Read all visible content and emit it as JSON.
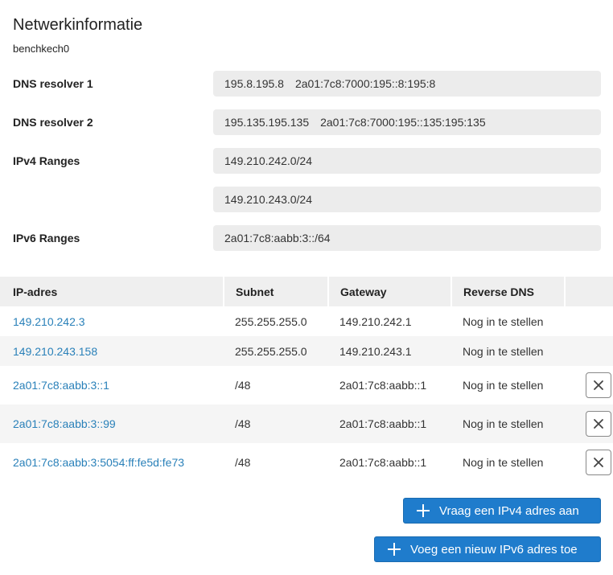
{
  "section": {
    "title": "Netwerkinformatie",
    "hostname": "benchkech0"
  },
  "info_rows": [
    {
      "label": "DNS resolver 1",
      "value_v4": "195.8.195.8",
      "value_v6": "2a01:7c8:7000:195::8:195:8"
    },
    {
      "label": "DNS resolver 2",
      "value_v4": "195.135.195.135",
      "value_v6": "2a01:7c8:7000:195::135:195:135"
    },
    {
      "label": "IPv4 Ranges",
      "value": "149.210.242.0/24"
    },
    {
      "label": "",
      "value": "149.210.243.0/24"
    },
    {
      "label": "IPv6 Ranges",
      "value": "2a01:7c8:aabb:3::/64"
    }
  ],
  "table": {
    "headers": [
      "IP-adres",
      "Subnet",
      "Gateway",
      "Reverse DNS"
    ],
    "rows": [
      {
        "ip": "149.210.242.3",
        "subnet": "255.255.255.0",
        "gateway": "149.210.242.1",
        "rdns": "Nog in te stellen"
      },
      {
        "ip": "149.210.243.158",
        "subnet": "255.255.255.0",
        "gateway": "149.210.243.1",
        "rdns": "Nog in te stellen"
      },
      {
        "ip": "2a01:7c8:aabb:3::1",
        "subnet": "/48",
        "gateway": "2a01:7c8:aabb::1",
        "rdns": "Nog in te stellen",
        "deletable": true
      },
      {
        "ip": "2a01:7c8:aabb:3::99",
        "subnet": "/48",
        "gateway": "2a01:7c8:aabb::1",
        "rdns": "Nog in te stellen",
        "deletable": true
      },
      {
        "ip": "2a01:7c8:aabb:3:5054:ff:fe5d:fe73",
        "subnet": "/48",
        "gateway": "2a01:7c8:aabb::1",
        "rdns": "Nog in te stellen",
        "deletable": true
      }
    ]
  },
  "buttons": {
    "request_ipv4": "Vraag een IPv4 adres aan",
    "add_ipv6": "Voeg een nieuw IPv6 adres toe"
  },
  "icons": {
    "add": "plus-icon",
    "delete": "close-icon"
  },
  "colors": {
    "link": "#2980b9",
    "primary_button": "#1f7ccc"
  }
}
